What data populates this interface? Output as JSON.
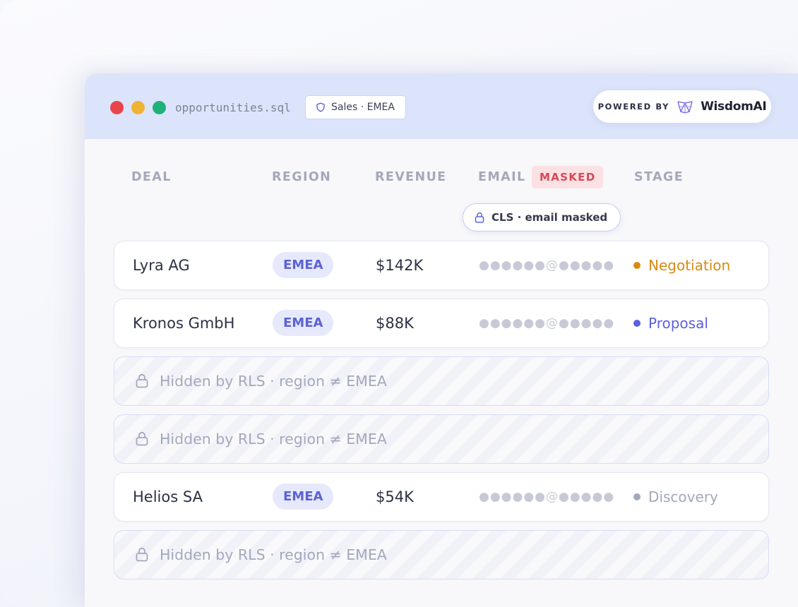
{
  "window": {
    "filename": "opportunities.sql",
    "scope_chip": "Sales · EMEA",
    "powered_by": "POWERED BY",
    "brand": "WisdomAI"
  },
  "columns": {
    "deal": "DEAL",
    "region": "REGION",
    "revenue": "REVENUE",
    "email": "EMAIL",
    "email_badge": "MASKED",
    "stage": "STAGE"
  },
  "cls_tooltip": "CLS · email masked",
  "rows": [
    {
      "type": "visible",
      "deal": "Lyra AG",
      "region": "EMEA",
      "revenue": "$142K",
      "email": "●●●●●●@●●●●●",
      "stage": "Negotiation",
      "stage_color": "#d98a12"
    },
    {
      "type": "visible",
      "deal": "Kronos GmbH",
      "region": "EMEA",
      "revenue": "$88K",
      "email": "●●●●●●@●●●●●",
      "stage": "Proposal",
      "stage_color": "#5b5fe0"
    },
    {
      "type": "hidden",
      "label": "Hidden by RLS · region ≠ EMEA"
    },
    {
      "type": "hidden",
      "label": "Hidden by RLS · region ≠ EMEA"
    },
    {
      "type": "visible",
      "deal": "Helios SA",
      "region": "EMEA",
      "revenue": "$54K",
      "email": "●●●●●●@●●●●●",
      "stage": "Discovery",
      "stage_color": "#a3a8bb"
    },
    {
      "type": "hidden",
      "label": "Hidden by RLS · region ≠ EMEA"
    }
  ],
  "colors": {
    "titlebar": "#dce4fb",
    "accent": "#5c62d6",
    "masked": "#d94855"
  },
  "icons": {
    "scope": "shield-icon",
    "cls": "lock-icon",
    "hidden": "lock-icon",
    "brand": "wisdomai-logo-icon"
  }
}
